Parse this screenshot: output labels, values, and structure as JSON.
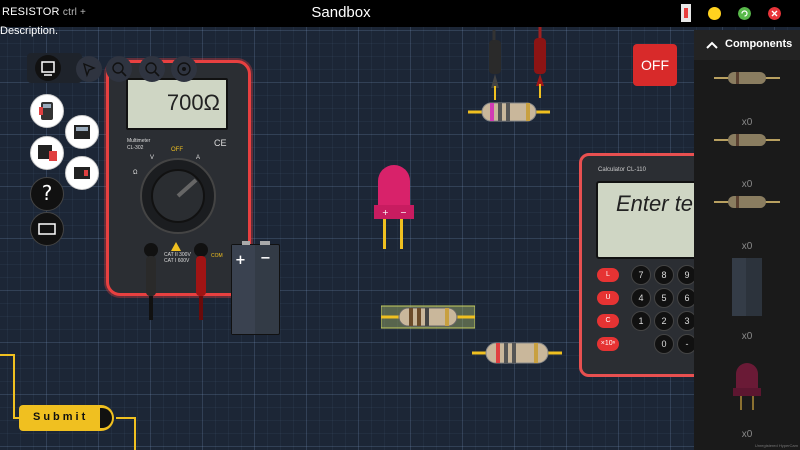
{
  "window": {
    "title": "Sandbox",
    "resistor_label": "RESISTOR",
    "resistor_shortcut": "ctrl +",
    "description": "Description."
  },
  "colors": {
    "win_yellow": "#ffd21f",
    "win_green": "#58b84a",
    "win_red": "#e8343a",
    "accent_red": "#e84040",
    "lead_yellow": "#f0c020"
  },
  "toolbar": {
    "items": [
      {
        "name": "monitor-icon"
      },
      {
        "name": "pointer-icon"
      },
      {
        "name": "zoom-in-icon"
      },
      {
        "name": "zoom-out-icon"
      },
      {
        "name": "fit-icon"
      }
    ]
  },
  "side_tools": [
    {
      "name": "multimeter-tool-icon"
    },
    {
      "name": "calculator-tool-icon"
    },
    {
      "name": "oscilloscope-tool-icon"
    },
    {
      "name": "board-tool-icon"
    },
    {
      "name": "help-icon",
      "glyph": "?"
    },
    {
      "name": "display-tool-icon"
    }
  ],
  "multimeter": {
    "reading": "700Ω",
    "model_line1": "Multimeter",
    "model_line2": "CL-302",
    "off_label": "OFF",
    "v_label": "V",
    "ohm_label": "Ω",
    "a_label": "A",
    "com_label": "COM",
    "vohm_label": "V\nΩ",
    "cat_line1": "CAT II 300V",
    "cat_line2": "CAT I 600V",
    "ce_label": "CE"
  },
  "power_button": {
    "label": "OFF"
  },
  "calculator": {
    "model": "Calculator  CL-110",
    "screen_text": "Enter te",
    "side_keys": [
      "L",
      "U",
      "C",
      "×10ⁿ"
    ],
    "keys": [
      "7",
      "8",
      "9",
      "4",
      "5",
      "6",
      "1",
      "2",
      "3",
      "0",
      ".",
      "-"
    ]
  },
  "battery": {
    "plus": "+",
    "minus": "−"
  },
  "led": {
    "plus": "+",
    "minus": "−"
  },
  "submit": {
    "label": "Submit"
  },
  "components_panel": {
    "title": "Components",
    "items": [
      {
        "type": "resistor",
        "count": "x0"
      },
      {
        "type": "resistor",
        "count": "x0"
      },
      {
        "type": "resistor",
        "count": "x0"
      },
      {
        "type": "battery",
        "count": "x0"
      },
      {
        "type": "led",
        "count": "x0"
      }
    ]
  },
  "watermark": "Unregistered HyperCam"
}
